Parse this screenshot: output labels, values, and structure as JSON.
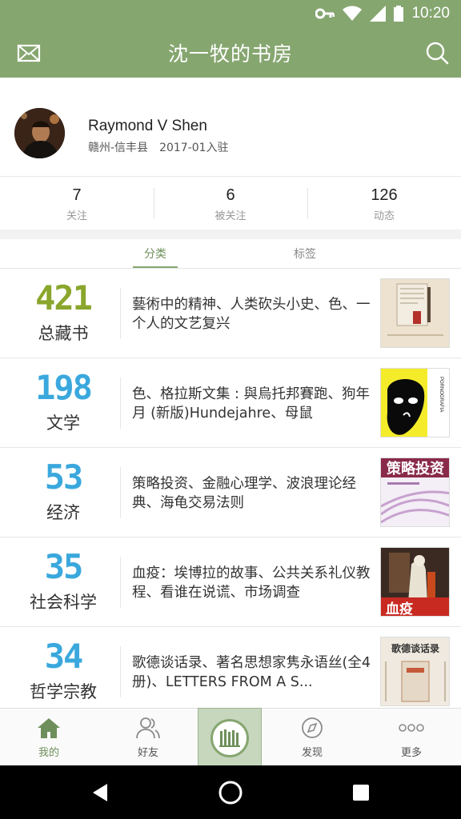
{
  "status_bar": {
    "time": "10:20"
  },
  "header": {
    "title": "沈一牧的书房"
  },
  "profile": {
    "name": "Raymond V Shen",
    "location": "赣州-信丰县",
    "joined": "2017-01入驻"
  },
  "stats": [
    {
      "value": "7",
      "label": "关注"
    },
    {
      "value": "6",
      "label": "被关注"
    },
    {
      "value": "126",
      "label": "动态"
    }
  ],
  "tabs": {
    "active": "分类",
    "inactive": "标签"
  },
  "categories": [
    {
      "count": "421",
      "name": "总藏书",
      "books": "藝術中的精神、人类砍头小史、色、一个人的文艺复兴",
      "color": "#8aa62c"
    },
    {
      "count": "198",
      "name": "文学",
      "books": "色、格拉斯文集 : 與烏托邦賽跑、狗年月 (新版)Hundejahre、母鼠",
      "color": "#3aa8dd"
    },
    {
      "count": "53",
      "name": "经济",
      "books": "策略投资、金融心理学、波浪理论经典、海龟交易法则",
      "color": "#3aa8dd"
    },
    {
      "count": "35",
      "name": "社会科学",
      "books": "血疫：埃博拉的故事、公共关系礼仪教程、看谁在说谎、市场调查",
      "color": "#3aa8dd"
    },
    {
      "count": "34",
      "name": "哲学宗教",
      "books": "歌德谈话录、著名思想家隽永语丝(全4册)、LETTERS FROM A S...",
      "color": "#3aa8dd"
    }
  ],
  "covers": {
    "c2_text": "PORNOGRAFIA",
    "c3_title": "策略投资",
    "c4_title": "血疫",
    "c5_title": "歌德谈话录"
  },
  "bottom_nav": {
    "home": "我的",
    "friends": "好友",
    "discover": "发现",
    "more": "更多"
  },
  "icons": [
    "key-icon",
    "wifi-icon",
    "signal-icon",
    "battery-icon",
    "mail-icon",
    "search-icon",
    "home-icon",
    "friends-icon",
    "bookshelf-icon",
    "compass-icon",
    "more-dots-icon",
    "back-icon",
    "home-circle-icon",
    "recents-icon"
  ],
  "colors": {
    "brand": "#86a670",
    "accent_green": "#8aa62c",
    "accent_blue": "#3aa8dd"
  }
}
